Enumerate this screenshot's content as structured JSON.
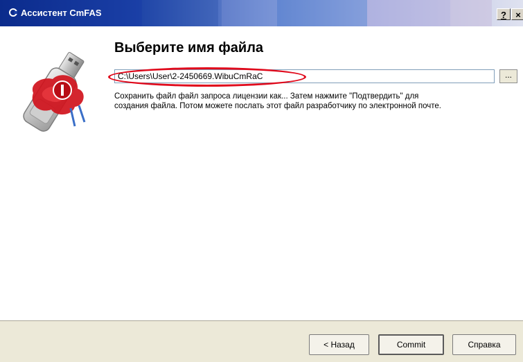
{
  "window": {
    "title": "Ассистент CmFAS",
    "title_icon": "cm-app-icon",
    "help_button": "?",
    "close_button": "×"
  },
  "main": {
    "heading": "Выберите имя файла",
    "file_path": "C:\\Users\\User\\2-2450669.WibuCmRaC",
    "browse_button": "...",
    "description_line1": "Сохранить файл файл запроса лицензии как... Затем нажмите \"Подтвердить\" для",
    "description_line2": "создания файла. Потом можете послать этот файл разработчику по электронной почте."
  },
  "footer": {
    "back_label": "< Назад",
    "commit_label": "Commit",
    "help_label": "Справка"
  },
  "colors": {
    "titlebar": "#0b2b8c",
    "highlight": "#e00a1c",
    "footer_bg": "#ece9d8"
  }
}
